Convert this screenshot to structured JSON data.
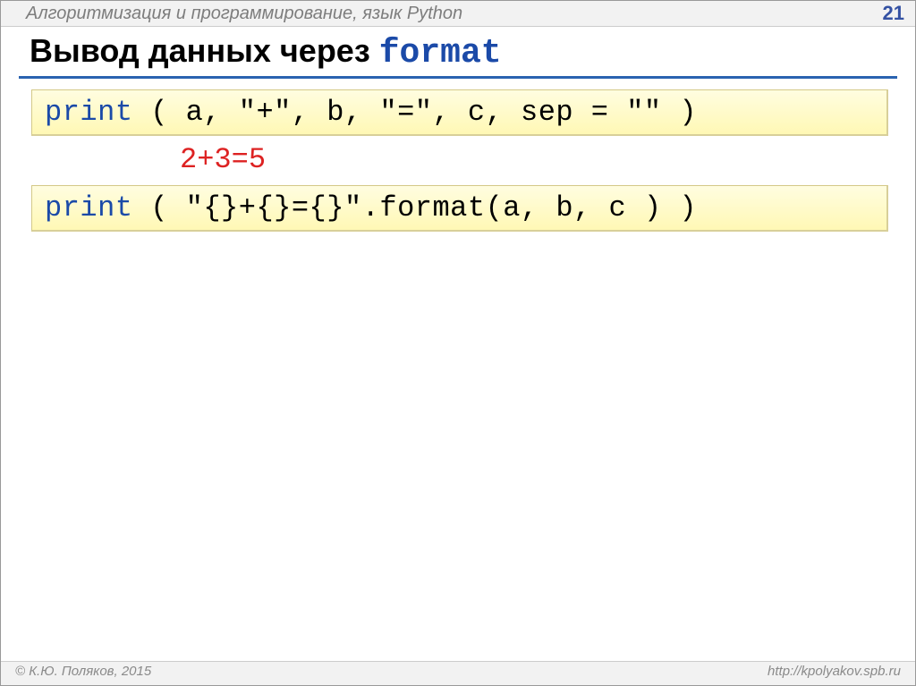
{
  "header": {
    "title": "Алгоритмизация и программирование, язык Python",
    "page": "21"
  },
  "title": {
    "prefix": "Вывод данных через ",
    "code": "format"
  },
  "code1": {
    "kw": "print",
    "rest": " ( a, \"+\", b, \"=\", c, sep = \"\" )"
  },
  "output": "2+3=5",
  "code2": {
    "kw": "print",
    "rest": " ( \"{}+{}={}\".format(a, b, c ) )"
  },
  "footer": {
    "copyright": "© К.Ю. Поляков, 2015",
    "url": "http://kpolyakov.spb.ru"
  }
}
